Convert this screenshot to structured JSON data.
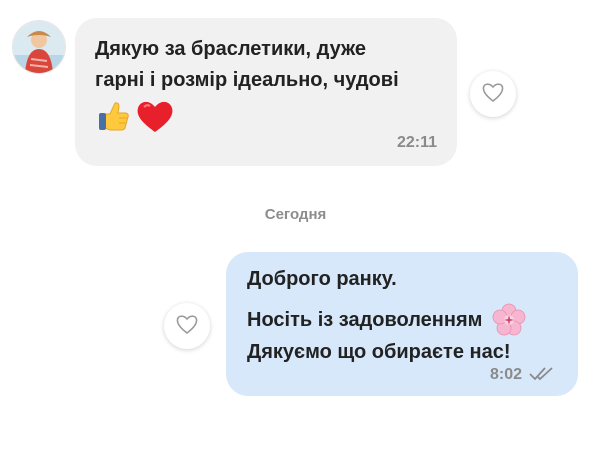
{
  "incoming": {
    "line1": "Дякую за браслетики, дуже",
    "line2": "гарні і розмір ідеально, чудові",
    "emoji": [
      "thumbs-up-icon",
      "red-heart-icon"
    ],
    "time": "22:11"
  },
  "date_separator": "Сегодня",
  "outgoing": {
    "line1": "Доброго ранку.",
    "line2": "Носіть із задоволенням",
    "line3": "Дякуємо що обираєте нас!",
    "time": "8:02",
    "status_icon": "double-check-icon",
    "emoji": "cherry-blossom-icon"
  },
  "colors": {
    "incoming_bubble": "#f1f1f1",
    "outgoing_bubble": "#d7e8fb",
    "time_text": "#8a8a8a"
  }
}
